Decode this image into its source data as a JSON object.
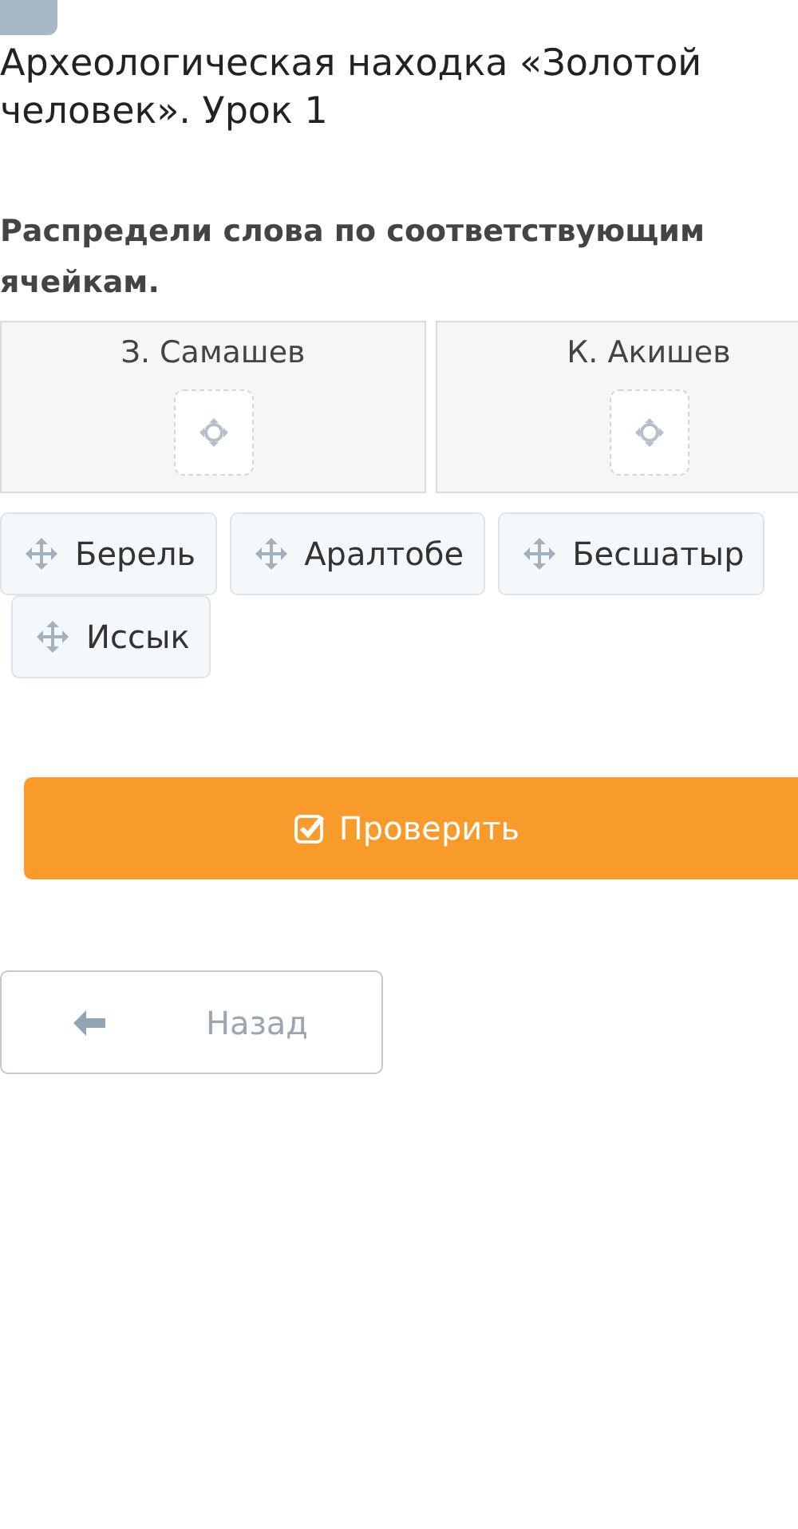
{
  "title": "Археологическая находка «Золотой человек». Урок 1",
  "instruction": "Распредели слова по соответствующим ячейкам.",
  "columns": [
    {
      "heading": "З. Самашев"
    },
    {
      "heading": "К. Акишев"
    }
  ],
  "words": [
    "Берель",
    "Аралтобе",
    "Бесшатыр",
    "Иссык"
  ],
  "check_button": "Проверить",
  "back_button": "Назад"
}
